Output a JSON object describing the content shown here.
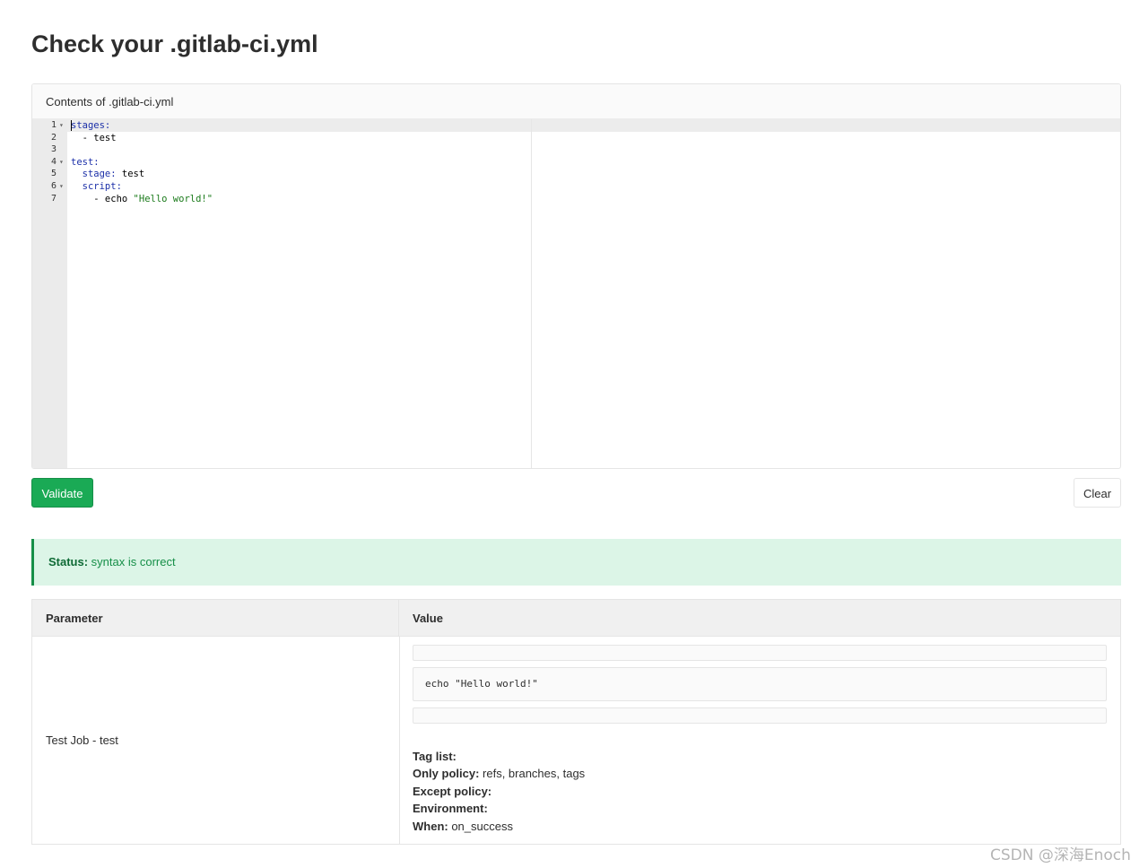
{
  "page": {
    "title": "Check your .gitlab-ci.yml"
  },
  "editor": {
    "header": "Contents of .gitlab-ci.yml",
    "lines": [
      {
        "num": "1",
        "fold": true,
        "segments": [
          {
            "text": "stages:",
            "kind": "key"
          }
        ]
      },
      {
        "num": "2",
        "fold": false,
        "segments": [
          {
            "text": "  - test",
            "kind": "plain"
          }
        ]
      },
      {
        "num": "3",
        "fold": false,
        "segments": []
      },
      {
        "num": "4",
        "fold": true,
        "segments": [
          {
            "text": "test:",
            "kind": "key"
          }
        ]
      },
      {
        "num": "5",
        "fold": false,
        "segments": [
          {
            "text": "  stage:",
            "kind": "key"
          },
          {
            "text": " test",
            "kind": "plain"
          }
        ]
      },
      {
        "num": "6",
        "fold": true,
        "segments": [
          {
            "text": "  script:",
            "kind": "key"
          }
        ]
      },
      {
        "num": "7",
        "fold": false,
        "segments": [
          {
            "text": "    - echo ",
            "kind": "plain"
          },
          {
            "text": "\"Hello world!\"",
            "kind": "string"
          }
        ]
      }
    ]
  },
  "buttons": {
    "validate": "Validate",
    "clear": "Clear"
  },
  "status": {
    "label": "Status:",
    "text": " syntax is correct"
  },
  "table": {
    "headers": {
      "parameter": "Parameter",
      "value": "Value"
    },
    "job": {
      "name": "Test Job - test",
      "script": "echo \"Hello world!\"",
      "tag_list_label": "Tag list:",
      "tag_list_value": "",
      "only_policy_label": "Only policy:",
      "only_policy_value": " refs, branches, tags",
      "except_policy_label": "Except policy:",
      "except_policy_value": "",
      "environment_label": "Environment:",
      "environment_value": "",
      "when_label": "When:",
      "when_value": " on_success"
    }
  },
  "watermark": "CSDN @深海Enoch",
  "colors": {
    "accent_green": "#1aaa55",
    "status_bg": "#dcf5e7",
    "keyword_blue": "#1b2fa8",
    "string_green": "#1a7a1a"
  }
}
